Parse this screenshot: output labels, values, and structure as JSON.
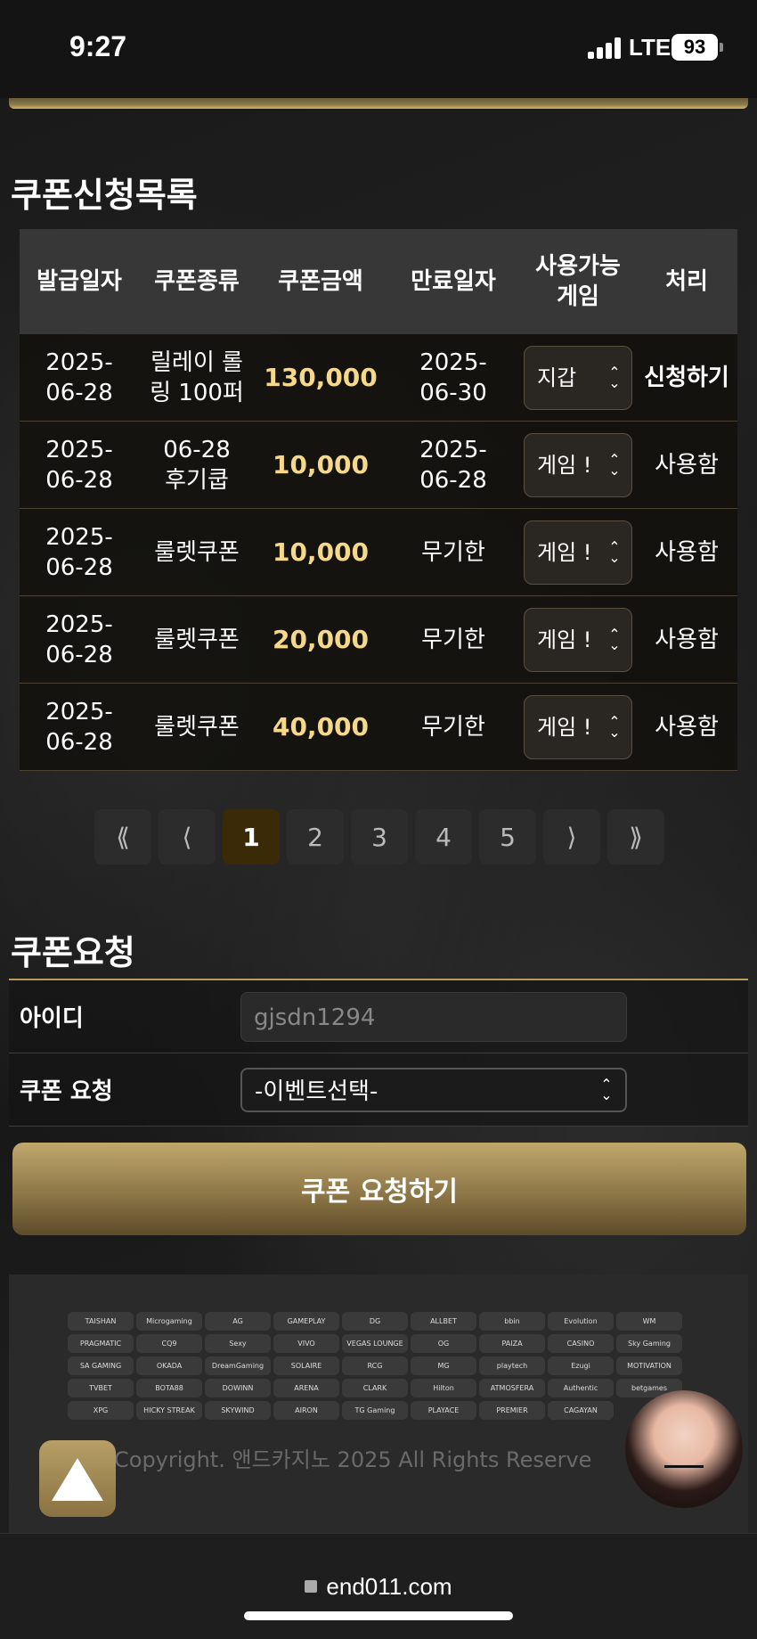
{
  "status": {
    "time": "9:27",
    "network": "LTE",
    "battery": "93"
  },
  "list_section": {
    "title": "쿠폰신청목록",
    "headers": [
      "발급일자",
      "쿠폰종류",
      "쿠폰금액",
      "만료일자",
      "사용가능\n게임",
      "처리"
    ],
    "rows": [
      {
        "issued": "2025-\n06-28",
        "type": "릴레이 롤\n링 100퍼",
        "amount": "130,000",
        "expiry": "2025-\n06-30",
        "game": "지갑",
        "action": "신청하기"
      },
      {
        "issued": "2025-\n06-28",
        "type": "06-28\n후기쿱",
        "amount": "10,000",
        "expiry": "2025-\n06-28",
        "game": "게임 !",
        "action": "사용함"
      },
      {
        "issued": "2025-\n06-28",
        "type": "룰렛쿠폰",
        "amount": "10,000",
        "expiry": "무기한",
        "game": "게임 !",
        "action": "사용함"
      },
      {
        "issued": "2025-\n06-28",
        "type": "룰렛쿠폰",
        "amount": "20,000",
        "expiry": "무기한",
        "game": "게임 !",
        "action": "사용함"
      },
      {
        "issued": "2025-\n06-28",
        "type": "룰렛쿠폰",
        "amount": "40,000",
        "expiry": "무기한",
        "game": "게임 !",
        "action": "사용함"
      }
    ]
  },
  "pagination": {
    "first": "⟪",
    "prev": "⟨",
    "pages": [
      "1",
      "2",
      "3",
      "4",
      "5"
    ],
    "current": "1",
    "next": "⟩",
    "last": "⟫"
  },
  "request_section": {
    "title": "쿠폰요청",
    "id_label": "아이디",
    "id_value": "gjsdn1294",
    "coupon_label": "쿠폰 요청",
    "coupon_select": "-이벤트선택-",
    "submit": "쿠폰 요청하기"
  },
  "footer": {
    "providers": [
      "TAISHAN",
      "Microgaming",
      "AG",
      "GAMEPLAY",
      "DG",
      "ALLBET",
      "bbin",
      "Evolution",
      "WM",
      "PRAGMATIC",
      "CQ9",
      "Sexy",
      "VIVO",
      "VEGAS LOUNGE",
      "OG",
      "PAIZA",
      "CASINO",
      "Sky Gaming",
      "SA GAMING",
      "OKADA",
      "DreamGaming",
      "SOLAIRE",
      "RCG",
      "MG",
      "playtech",
      "Ezugi",
      "MOTIVATION",
      "TVBET",
      "BOTA88",
      "DOWINN",
      "ARENA",
      "CLARK",
      "Hilton",
      "ATMOSFERA",
      "Authentic",
      "betgames",
      "XPG",
      "HICKY STREAK",
      "SKYWIND",
      "AIRON",
      "TG Gaming",
      "PLAYACE",
      "PREMIER",
      "CAGAYAN",
      ""
    ],
    "copyright": "Copyright. 앤드카지노 2025 All Rights Reserve"
  },
  "browser": {
    "url": "end011.com"
  }
}
